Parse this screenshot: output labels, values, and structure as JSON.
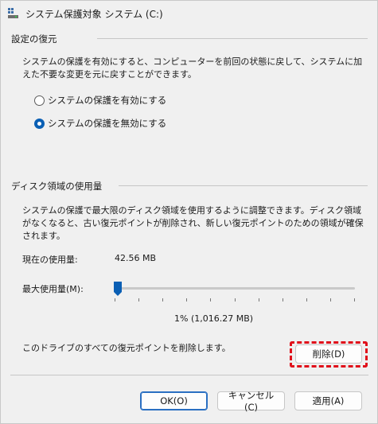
{
  "window": {
    "title": "システム保護対象 システム (C:)",
    "icon": "system-protection-icon"
  },
  "restore_settings": {
    "group_label": "設定の復元",
    "description": "システムの保護を有効にすると、コンピューターを前回の状態に戻して、システムに加えた不要な変更を元に戻すことができます。",
    "options": [
      {
        "label": "システムの保護を有効にする",
        "checked": false
      },
      {
        "label": "システムの保護を無効にする",
        "checked": true
      }
    ]
  },
  "disk_usage": {
    "group_label": "ディスク領域の使用量",
    "description": "システムの保護で最大限のディスク領域を使用するように調整できます。ディスク領域がなくなると、古い復元ポイントが削除され、新しい復元ポイントのための領域が確保されます。",
    "current_usage_label": "現在の使用量:",
    "current_usage_value": "42.56 MB",
    "max_usage_label": "最大使用量(M):",
    "max_usage_fraction": 0.01,
    "max_usage_readout": "1% (1,016.27 MB)",
    "delete_description": "このドライブのすべての復元ポイントを削除します。",
    "delete_button": "削除(D)",
    "highlight_color": "#e0101b"
  },
  "footer": {
    "ok_button": "OK(O)",
    "cancel_button": "キャンセル(C)",
    "apply_button": "適用(A)"
  },
  "colors": {
    "accent": "#0a5fb4"
  }
}
